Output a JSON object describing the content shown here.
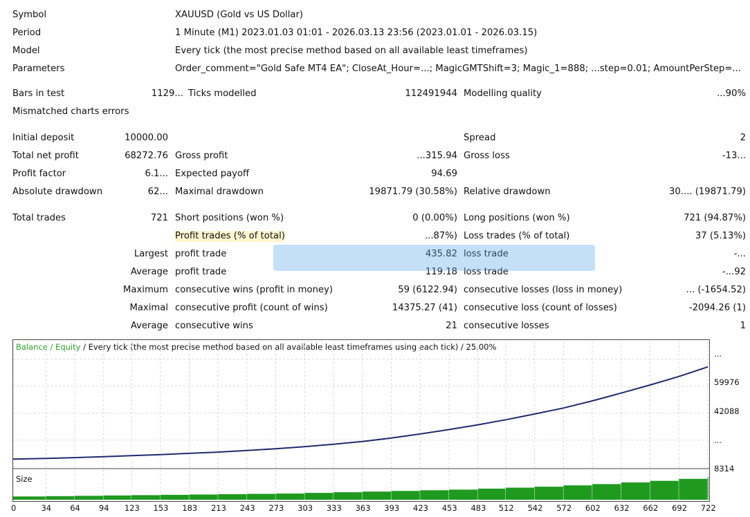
{
  "report": {
    "header": {
      "symbol_label": "Symbol",
      "symbol_value": "XAUUSD (Gold vs US Dollar)",
      "period_label": "Period",
      "period_value": "1 Minute (M1) 2023.01.03 01:01 - 2026.03.13 23:56 (2023.01.01 - 2026.03.15)",
      "model_label": "Model",
      "model_value": "Every tick (the most precise method based on all available least timeframes)",
      "parameters_label": "Parameters",
      "parameters_value": "Order_comment=\"Gold Safe MT4 EA\"; CloseAt_Hour=...; MagicGMTShift=3; Magic_1=888; ...step=0.01; AmountPerStep=..."
    },
    "bars_row": {
      "bars_label": "Bars in test",
      "bars_value": "1129...",
      "ticks_label": "Ticks modelled",
      "ticks_value": "112491944",
      "quality_label": "Modelling quality",
      "quality_value": "...90%"
    },
    "mismatched_label": "Mismatched charts errors",
    "initial_deposit_label": "Initial deposit",
    "initial_deposit_value": "10000.00",
    "spread_label": "Spread",
    "spread_value": "2",
    "total_net_profit_label": "Total net profit",
    "total_net_profit_value": "68272.76",
    "gross_profit_label": "Gross profit",
    "gross_profit_value": "...315.94",
    "gross_loss_label": "Gross loss",
    "gross_loss_value": "-13...",
    "profit_factor_label": "Profit factor",
    "profit_factor_value": "6.1...",
    "expected_payoff_label": "Expected payoff",
    "expected_payoff_value": "94.69",
    "absolute_drawdown_label": "Absolute drawdown",
    "absolute_drawdown_value": "62...",
    "maximal_drawdown_label": "Maximal drawdown",
    "maximal_drawdown_value": "19871.79 (30.58%)",
    "relative_drawdown_label": "Relative drawdown",
    "relative_drawdown_value": "30.... (19871.79)",
    "total_trades_label": "Total trades",
    "total_trades_value": "721",
    "short_positions_label": "Short positions (won %)",
    "short_positions_value": "0 (0.00%)",
    "long_positions_label": "Long positions (won %)",
    "long_positions_value": "721 (94.87%)",
    "profit_trades_label": "Profit trades (% of total)",
    "profit_trades_value": "...87%)",
    "loss_trades_label": "Loss trades (% of total)",
    "loss_trades_value": "37 (5.13%)",
    "largest_label": "Largest",
    "largest_profit_label": "profit trade",
    "largest_profit_value": "435.82",
    "largest_loss_label": "loss trade",
    "largest_loss_value": "-...",
    "average_label": "Average",
    "average_profit_label": "profit trade",
    "average_profit_value": "119.18",
    "average_loss_label": "loss trade",
    "average_loss_value": "-...92",
    "maximum_label": "Maximum",
    "max_consec_wins_label": "consecutive wins (profit in money)",
    "max_consec_wins_value": "59 (6122.94)",
    "max_consec_losses_label": "consecutive losses (loss in money)",
    "max_consec_losses_value": "... (-1654.52)",
    "maximal_label": "Maximal",
    "maximal_consec_profit_label": "consecutive profit (count of wins)",
    "maximal_consec_profit_value": "14375.27 (41)",
    "maximal_consec_loss_label": "consecutive loss (count of losses)",
    "maximal_consec_loss_value": "-2094.26 (1)",
    "average2_label": "Average",
    "avg_consec_wins_label": "consecutive wins",
    "avg_consec_wins_value": "21",
    "avg_consec_losses_label": "consecutive losses",
    "avg_consec_losses_value": "1"
  },
  "chart": {
    "title_prefix": "Balance / Equity",
    "title_rest": " / Every tick (the most precise method based on all available least timeframes using each tick) / 25.00%",
    "size_label": "Size",
    "line_color": "#1f2a6e",
    "bar_color": "#1f9a1f"
  },
  "chart_data": {
    "type": "line",
    "title": "Balance / Equity / Every tick (the most precise method based on all available least timeframes using each tick) / 25.00%",
    "x_ticks": [
      "0",
      "34",
      "64",
      "94",
      "123",
      "153",
      "183",
      "213",
      "243",
      "273",
      "303",
      "333",
      "363",
      "393",
      "423",
      "453",
      "483",
      "512",
      "542",
      "572",
      "602",
      "632",
      "662",
      "692",
      "722"
    ],
    "y_ticks": [
      "8314",
      "...",
      "42088",
      "59976",
      "..."
    ],
    "ylim": [
      8314,
      79000
    ],
    "xlim": [
      0,
      722
    ],
    "series": [
      {
        "name": "Balance",
        "x": [
          0,
          34,
          64,
          94,
          123,
          153,
          183,
          213,
          243,
          273,
          303,
          333,
          363,
          393,
          423,
          453,
          483,
          512,
          542,
          572,
          602,
          632,
          662,
          692,
          722
        ],
        "values": [
          10000,
          10500,
          11000,
          11600,
          12300,
          13000,
          13800,
          14600,
          15700,
          16800,
          18200,
          19800,
          21600,
          23800,
          26500,
          29400,
          32500,
          35800,
          39600,
          43500,
          48200,
          53300,
          58600,
          64200,
          70500
        ]
      }
    ],
    "size_series": {
      "name": "Size",
      "x": [
        0,
        34,
        64,
        94,
        123,
        153,
        183,
        213,
        243,
        273,
        303,
        333,
        363,
        393,
        423,
        453,
        483,
        512,
        542,
        572,
        602,
        632,
        662,
        692,
        722
      ],
      "values": [
        0.1,
        0.11,
        0.12,
        0.13,
        0.14,
        0.15,
        0.16,
        0.17,
        0.18,
        0.19,
        0.21,
        0.23,
        0.25,
        0.27,
        0.29,
        0.31,
        0.34,
        0.37,
        0.4,
        0.44,
        0.48,
        0.53,
        0.58,
        0.64,
        0.7
      ]
    }
  }
}
